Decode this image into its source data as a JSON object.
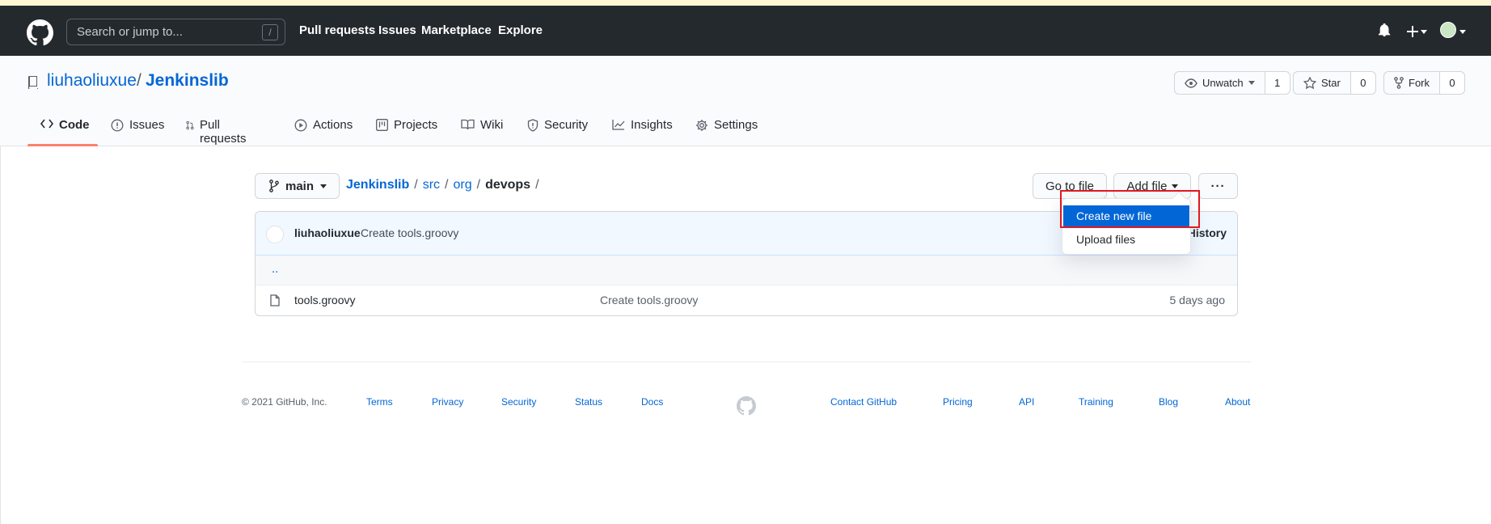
{
  "header": {
    "search_placeholder": "Search or jump to...",
    "search_shortcut": "/",
    "nav": [
      "Pull requests",
      "Issues",
      "Marketplace",
      "Explore"
    ],
    "icons": [
      "github-logo-icon",
      "bell-icon",
      "plus-icon",
      "avatar"
    ]
  },
  "repo": {
    "owner": "liuhaoliuxue",
    "separator": "/",
    "name": "Jenkinslib",
    "watch": {
      "label": "Unwatch",
      "count": "1"
    },
    "star": {
      "label": "Star",
      "count": "0"
    },
    "fork": {
      "label": "Fork",
      "count": "0"
    }
  },
  "tabs": [
    {
      "label": "Code",
      "icon": "code-icon",
      "active": true
    },
    {
      "label": "Issues",
      "icon": "issue-opened-icon"
    },
    {
      "label": "Pull requests",
      "icon": "git-pull-request-icon"
    },
    {
      "label": "Actions",
      "icon": "play-icon"
    },
    {
      "label": "Projects",
      "icon": "project-icon"
    },
    {
      "label": "Wiki",
      "icon": "book-icon"
    },
    {
      "label": "Security",
      "icon": "shield-icon"
    },
    {
      "label": "Insights",
      "icon": "graph-icon"
    },
    {
      "label": "Settings",
      "icon": "gear-icon"
    }
  ],
  "browser": {
    "branch": "main",
    "path": [
      {
        "label": "Jenkinslib"
      },
      {
        "label": "src"
      },
      {
        "label": "org"
      },
      {
        "label": "devops"
      }
    ],
    "path_sep": "/",
    "go_to_file": "Go to file",
    "add_file": "Add file",
    "more": "···"
  },
  "dropdown": {
    "items": [
      "Create new file",
      "Upload files"
    ]
  },
  "commit": {
    "author": "liuhaoliuxue",
    "message": "Create tools.groovy",
    "history": "History"
  },
  "files": {
    "parent": "..",
    "rows": [
      {
        "name": "tools.groovy",
        "message": "Create tools.groovy",
        "age": "5 days ago"
      }
    ]
  },
  "footer": {
    "copyright": "© 2021 GitHub, Inc.",
    "left_links": [
      "Terms",
      "Privacy",
      "Security",
      "Status",
      "Docs"
    ],
    "right_links": [
      "Contact GitHub",
      "Pricing",
      "API",
      "Training",
      "Blog",
      "About"
    ]
  },
  "colors": {
    "header_bg": "#24292e",
    "link": "#0366d6",
    "active_tab": "#f9826c",
    "highlight": "#e0191f",
    "commit_bar": "#f1f8ff"
  }
}
